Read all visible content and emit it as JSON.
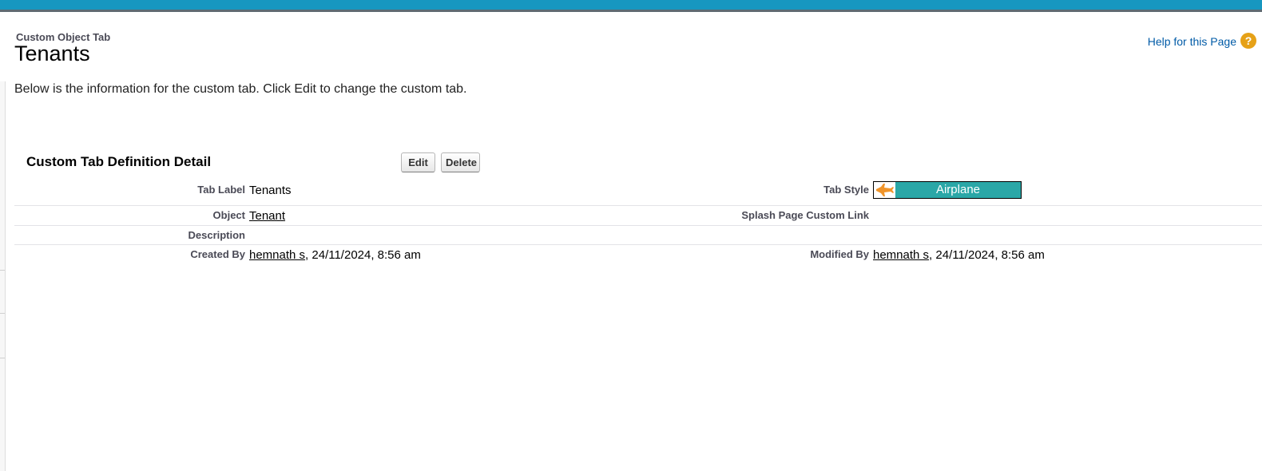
{
  "header": {
    "page_type": "Custom Object Tab",
    "title": "Tenants",
    "help_link": "Help for this Page",
    "help_icon_glyph": "?"
  },
  "intro_text": "Below is the information for the custom tab. Click Edit to change the custom tab.",
  "detail": {
    "section_title": "Custom Tab Definition Detail",
    "edit_label": "Edit",
    "delete_label": "Delete",
    "tab_label_label": "Tab Label",
    "tab_label_value": "Tenants",
    "tab_style_label": "Tab Style",
    "tab_style_value": "Airplane",
    "tab_style_icon": "airplane-icon",
    "tab_style_color": "#2aa7a7",
    "object_label": "Object",
    "object_value": "Tenant",
    "splash_label": "Splash Page Custom Link",
    "description_label": "Description",
    "created_by_label": "Created By",
    "created_by_user": "hemnath s",
    "created_by_date": ", 24/11/2024, 8:56 am",
    "modified_by_label": "Modified By",
    "modified_by_user": "hemnath s",
    "modified_by_date": ", 24/11/2024, 8:56 am"
  },
  "colors": {
    "top_bar": "#1797c0",
    "link": "#015ba7",
    "help_icon": "#e6a117"
  }
}
